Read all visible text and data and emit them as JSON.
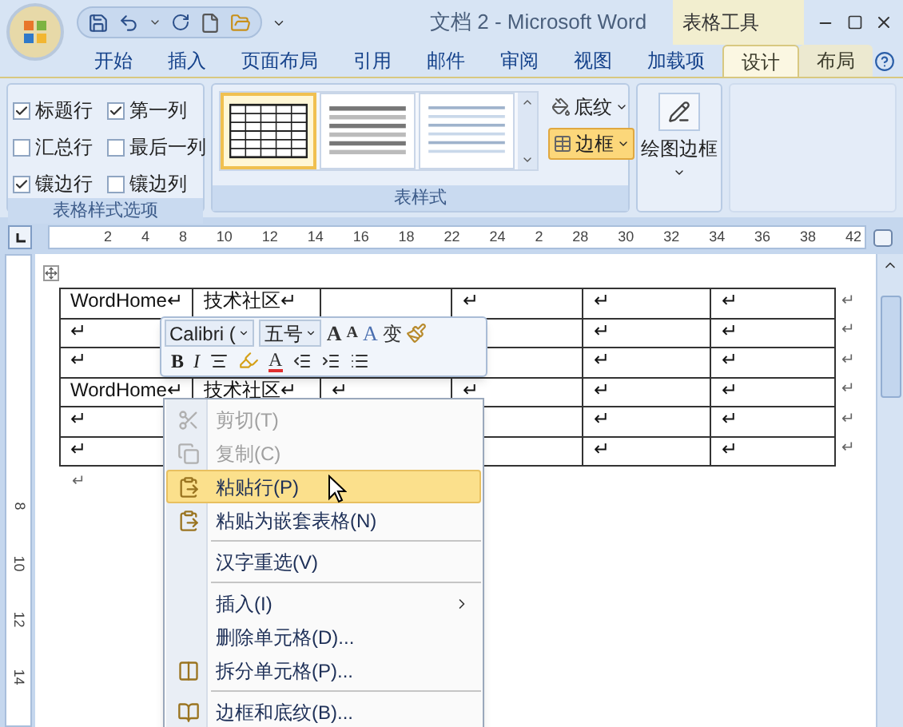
{
  "window": {
    "title": "文档 2 - Microsoft Word",
    "tool_group": "表格工具"
  },
  "tabs": [
    {
      "label": "开始",
      "selected": false,
      "contextual": false
    },
    {
      "label": "插入",
      "selected": false,
      "contextual": false
    },
    {
      "label": "页面布局",
      "selected": false,
      "contextual": false
    },
    {
      "label": "引用",
      "selected": false,
      "contextual": false
    },
    {
      "label": "邮件",
      "selected": false,
      "contextual": false
    },
    {
      "label": "审阅",
      "selected": false,
      "contextual": false
    },
    {
      "label": "视图",
      "selected": false,
      "contextual": false
    },
    {
      "label": "加载项",
      "selected": false,
      "contextual": false
    },
    {
      "label": "设计",
      "selected": true,
      "contextual": true
    },
    {
      "label": "布局",
      "selected": false,
      "contextual": true
    }
  ],
  "style_options": {
    "title": "表格样式选项",
    "options": [
      {
        "label": "标题行",
        "checked": true
      },
      {
        "label": "第一列",
        "checked": true
      },
      {
        "label": "汇总行",
        "checked": false
      },
      {
        "label": "最后一列",
        "checked": false
      },
      {
        "label": "镶边行",
        "checked": true
      },
      {
        "label": "镶边列",
        "checked": false
      }
    ]
  },
  "table_styles": {
    "title": "表样式",
    "styles": [
      {
        "kind": "grid",
        "selected": true
      },
      {
        "kind": "banded",
        "selected": false
      },
      {
        "kind": "light",
        "selected": false
      }
    ],
    "shading": "底纹",
    "borders": {
      "label": "边框",
      "active": true
    }
  },
  "draw_borders": {
    "label": "绘图边框"
  },
  "ruler": {
    "labels": [
      "2",
      "4",
      "8",
      "10",
      "12",
      "14",
      "16",
      "18",
      "22",
      "24",
      "2",
      "28",
      "30",
      "32",
      "34",
      "36",
      "38",
      "42"
    ]
  },
  "vertical_ruler": {
    "labels": [
      "8",
      "10",
      "12",
      "14"
    ]
  },
  "table": {
    "rows": [
      {
        "cells": [
          "WordHome↵",
          "技术社区↵",
          null,
          "↵",
          "↵",
          "↵"
        ],
        "end_mark": "↵"
      },
      {
        "cells": [
          "↵",
          null,
          null,
          null,
          "↵",
          "↵"
        ],
        "end_mark": "↵"
      },
      {
        "cells": [
          "↵",
          null,
          null,
          null,
          "↵",
          "↵"
        ],
        "end_mark": "↵"
      },
      {
        "cells": [
          "WordHome↵",
          "技术社区↵",
          "↵",
          "↵",
          "↵",
          "↵"
        ],
        "end_mark": "↵"
      },
      {
        "cells": [
          "↵",
          null,
          null,
          null,
          "↵",
          "↵"
        ],
        "end_mark": "↵"
      },
      {
        "cells": [
          "↵",
          null,
          null,
          null,
          "↵",
          "↵"
        ],
        "end_mark": "↵"
      }
    ]
  },
  "after_table": "↵",
  "mini_toolbar": {
    "font": "Calibri (",
    "size": "五号",
    "grow": "A",
    "shrink": "A",
    "styles": "A",
    "phonetic": "变",
    "bold": "B",
    "italic": "I",
    "font_color": "A"
  },
  "context_menu": {
    "items": [
      {
        "kind": "item",
        "label": "剪切(T)",
        "disabled": true,
        "selected": false
      },
      {
        "kind": "item",
        "label": "复制(C)",
        "disabled": true,
        "selected": false
      },
      {
        "kind": "item",
        "label": "粘贴行(P)",
        "disabled": false,
        "selected": true
      },
      {
        "kind": "item",
        "label": "粘贴为嵌套表格(N)",
        "disabled": false,
        "selected": false
      },
      {
        "kind": "separator"
      },
      {
        "kind": "item",
        "label": "汉字重选(V)",
        "disabled": false,
        "selected": false
      },
      {
        "kind": "separator"
      },
      {
        "kind": "submenu",
        "label": "插入(I)",
        "disabled": false,
        "selected": false
      },
      {
        "kind": "item",
        "label": "删除单元格(D)...",
        "disabled": false,
        "selected": false
      },
      {
        "kind": "item",
        "label": "拆分单元格(P)...",
        "disabled": false,
        "selected": false
      },
      {
        "kind": "separator"
      },
      {
        "kind": "item",
        "label": "边框和底纹(B)...",
        "disabled": false,
        "selected": false
      }
    ]
  }
}
